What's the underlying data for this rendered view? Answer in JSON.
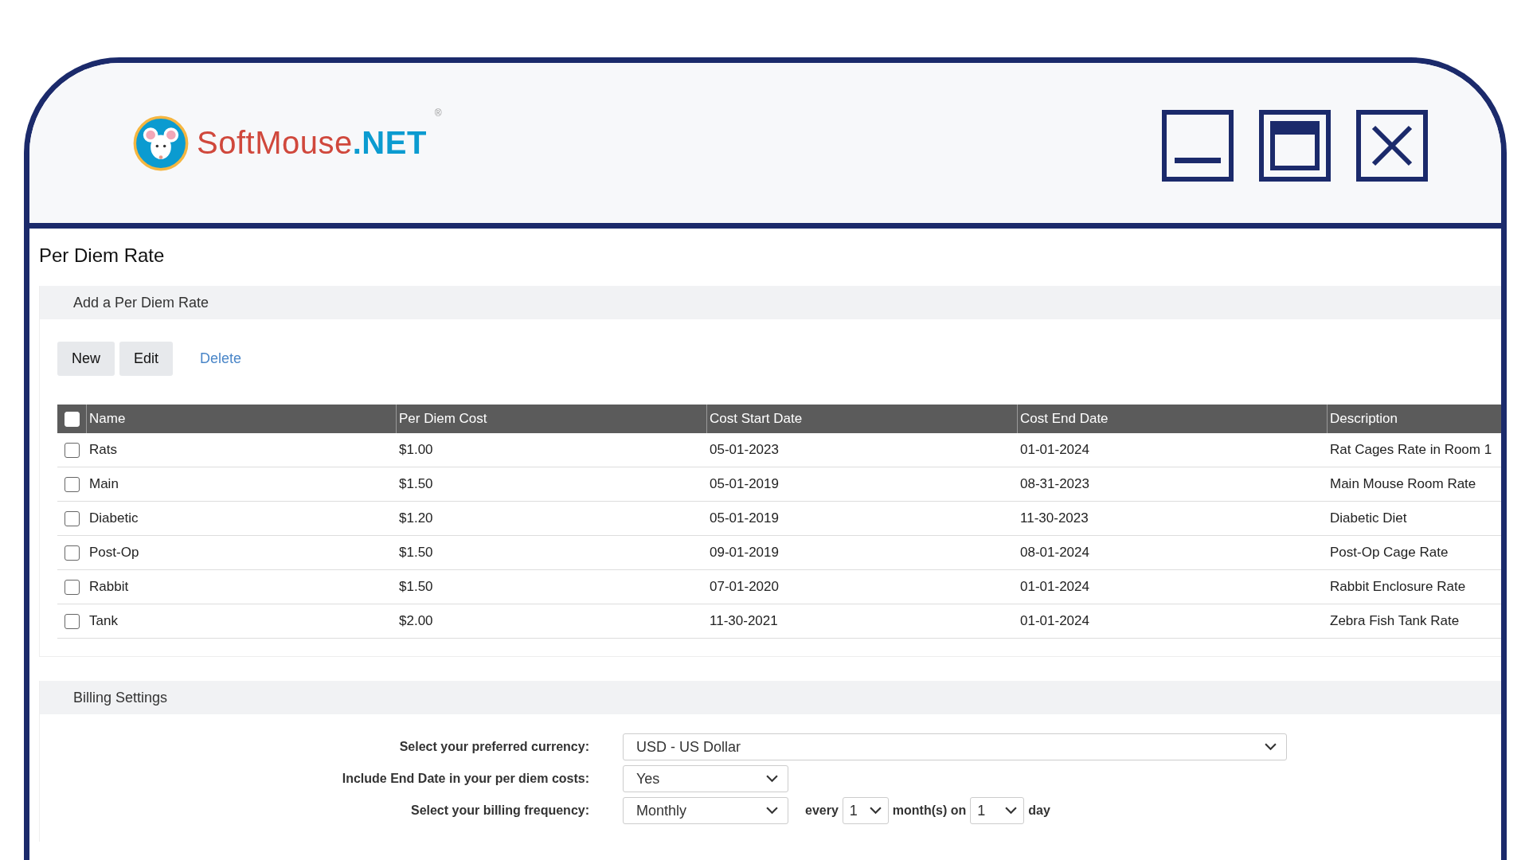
{
  "app": {
    "logo_name": "SoftMouse",
    "logo_suffix": ".NET",
    "logo_mark": "®"
  },
  "page": {
    "title": "Per Diem Rate"
  },
  "rate_section": {
    "title": "Add a Per Diem Rate",
    "buttons": [
      {
        "label": "New",
        "kind": "button"
      },
      {
        "label": "Edit",
        "kind": "button"
      },
      {
        "label": "Delete",
        "kind": "link"
      }
    ],
    "table": {
      "select_all_checked": false,
      "columns": [
        "Name",
        "Per Diem Cost",
        "Cost Start Date",
        "Cost End Date",
        "Description"
      ],
      "rows": [
        {
          "checked": false,
          "cells": [
            "Rats",
            "$1.00",
            "05-01-2023",
            "01-01-2024",
            "Rat Cages Rate in Room 1"
          ]
        },
        {
          "checked": false,
          "cells": [
            "Main",
            "$1.50",
            "05-01-2019",
            "08-31-2023",
            "Main Mouse Room Rate"
          ]
        },
        {
          "checked": false,
          "cells": [
            "Diabetic",
            "$1.20",
            "05-01-2019",
            "11-30-2023",
            "Diabetic Diet"
          ]
        },
        {
          "checked": false,
          "cells": [
            "Post-Op",
            "$1.50",
            "09-01-2019",
            "08-01-2024",
            "Post-Op Cage Rate"
          ]
        },
        {
          "checked": false,
          "cells": [
            "Rabbit",
            "$1.50",
            "07-01-2020",
            "01-01-2024",
            "Rabbit Enclosure Rate"
          ]
        },
        {
          "checked": false,
          "cells": [
            "Tank",
            "$2.00",
            "11-30-2021",
            "01-01-2024",
            "Zebra Fish Tank Rate"
          ]
        }
      ]
    }
  },
  "billing": {
    "title": "Billing Settings",
    "currency": {
      "label": "Select your preferred currency:",
      "value": "USD - US Dollar"
    },
    "include_end_date": {
      "label": "Include End Date in your per diem costs:",
      "value": "Yes"
    },
    "frequency": {
      "label": "Select your billing frequency:",
      "value": "Monthly",
      "every_label": "every",
      "every_value": "1",
      "months_label": "month(s) on",
      "day_value": "1",
      "day_label": "day"
    }
  }
}
